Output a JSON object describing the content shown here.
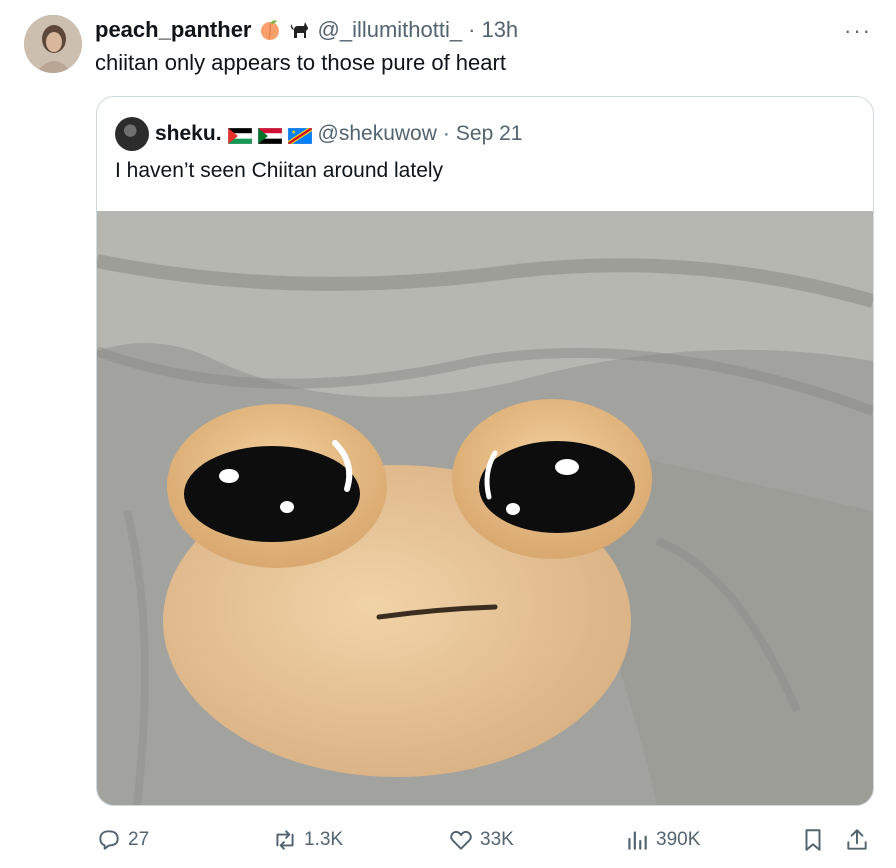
{
  "tweet": {
    "author": {
      "display_name": "peach_panther",
      "handle": "@_illumithotti_",
      "time": "13h"
    },
    "separator": "·",
    "text": "chiitan only appears to those pure of heart",
    "more_label": "···"
  },
  "quoted": {
    "author": {
      "display_name": "sheku.",
      "handle": "@shekuwow",
      "date": "Sep 21"
    },
    "separator": "·",
    "text": "I haven’t seen Chiitan around lately",
    "flags": [
      "palestine-flag",
      "sudan-flag",
      "congo-flag"
    ]
  },
  "actions": {
    "replies": "27",
    "reposts": "1.3K",
    "likes": "33K",
    "views": "390K"
  },
  "colors": {
    "muted": "#536471",
    "border": "#cfd9de",
    "text": "#0f1419"
  }
}
